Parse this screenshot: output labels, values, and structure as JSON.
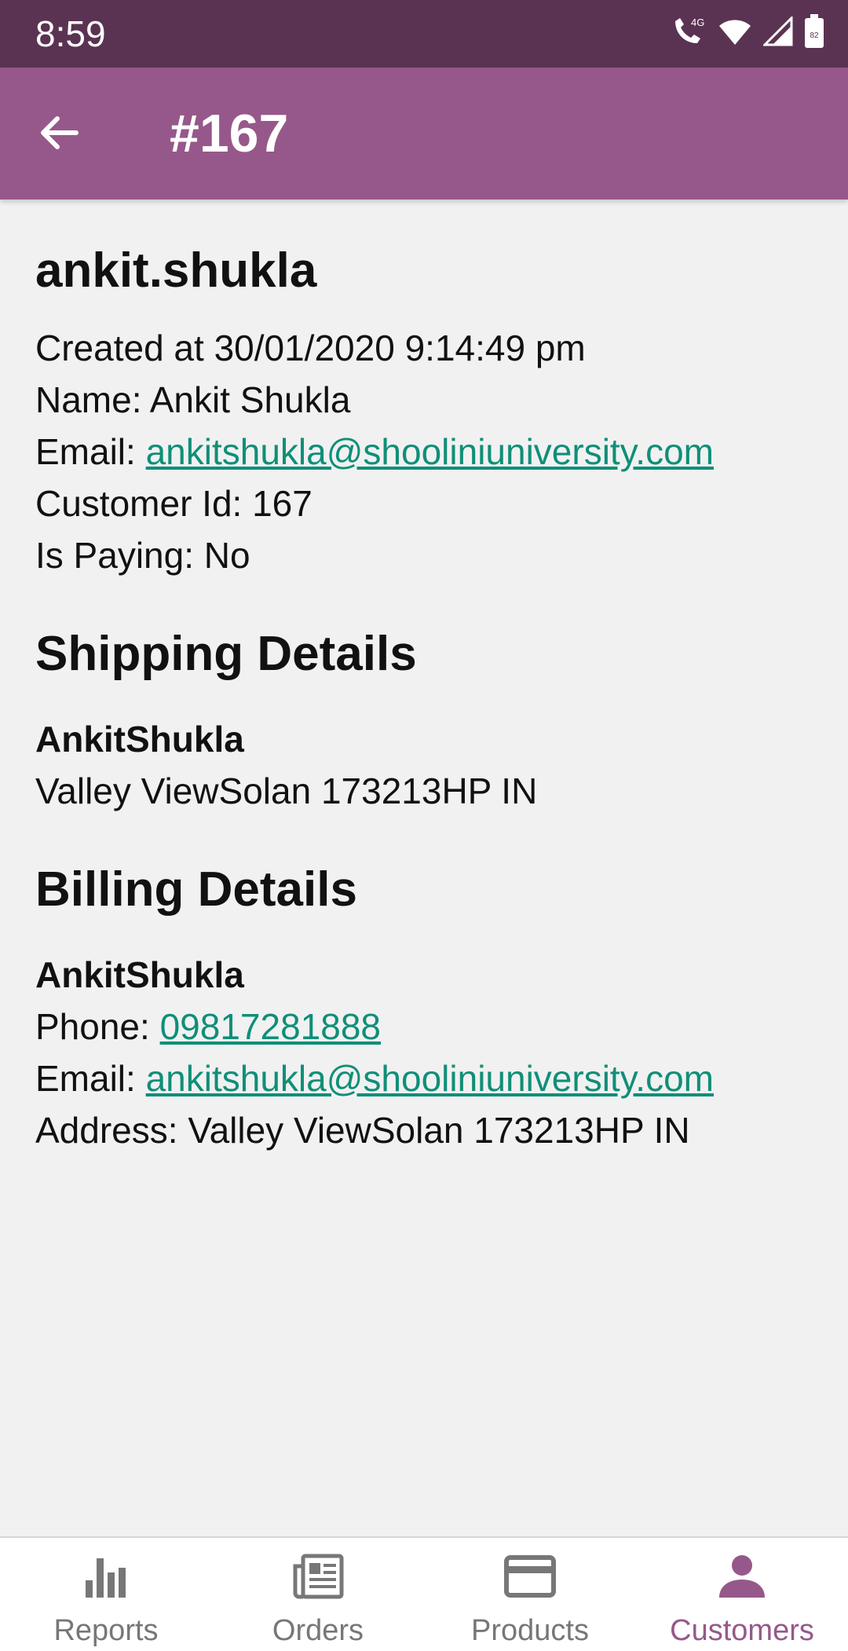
{
  "status_bar": {
    "time": "8:59",
    "battery": "82"
  },
  "app_bar": {
    "title": "#167"
  },
  "customer": {
    "username": "ankit.shukla",
    "created": "Created at 30/01/2020 9:14:49 pm",
    "name_label": "Name: ",
    "name_value": "Ankit Shukla",
    "email_label": "Email: ",
    "email_value": "ankitshukla@shooliniuniversity.com",
    "id_label": "Customer Id: ",
    "id_value": "167",
    "paying_label": "Is Paying: ",
    "paying_value": "No"
  },
  "shipping": {
    "title": "Shipping Details",
    "name": "AnkitShukla",
    "address": "Valley ViewSolan 173213HP IN"
  },
  "billing": {
    "title": "Billing Details",
    "name": "AnkitShukla",
    "phone_label": "Phone: ",
    "phone_value": "09817281888",
    "email_label": "Email: ",
    "email_value": "ankitshukla@shooliniuniversity.com",
    "address_label": "Address: ",
    "address_value": "Valley ViewSolan 173213HP IN"
  },
  "bottom_nav": {
    "items": [
      {
        "label": "Reports",
        "icon": "bar-chart-icon"
      },
      {
        "label": "Orders",
        "icon": "newspaper-icon"
      },
      {
        "label": "Products",
        "icon": "card-icon"
      },
      {
        "label": "Customers",
        "icon": "person-icon",
        "active": true
      }
    ]
  },
  "colors": {
    "status_bar": "#5b3352",
    "app_bar": "#96588a",
    "link": "#0f8f78",
    "active_nav": "#96588a"
  }
}
